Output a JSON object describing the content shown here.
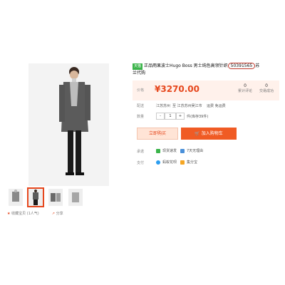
{
  "product": {
    "title_prefix": "天猫",
    "title_main": "正品雨果波士Hugo Boss 男士纯色高领针织",
    "item_number": "50391565",
    "title_tail": "苏",
    "title_line2": "兰代购"
  },
  "price": {
    "label": "价格",
    "value": "¥3270.00",
    "stats": [
      {
        "num": "0",
        "label": "累计评论"
      },
      {
        "num": "0",
        "label": "交易成功"
      }
    ]
  },
  "shipping": {
    "label": "配送",
    "from": "江苏苏州",
    "to": "至  江苏苏州吴江市",
    "fee": "运费 免运费"
  },
  "quantity": {
    "label": "数量",
    "minus": "-",
    "value": "1",
    "plus": "+",
    "stock": "件(库存39件)"
  },
  "actions": {
    "buy_now": "立即购买",
    "add_cart": "加入购物车"
  },
  "promise": {
    "label": "承诺",
    "items": [
      "现货速发",
      "7天无理由"
    ]
  },
  "payment": {
    "label": "支付",
    "items": [
      "蚂蚁花呗",
      "集分宝"
    ]
  },
  "footer": {
    "favorite": "收藏宝贝 (1人气)",
    "share": "分享"
  },
  "colors": {
    "accent": "#e6471d",
    "cart_button": "#f05b24",
    "price_bg": "#fff1eb",
    "tag_green": "#3bb44a"
  }
}
